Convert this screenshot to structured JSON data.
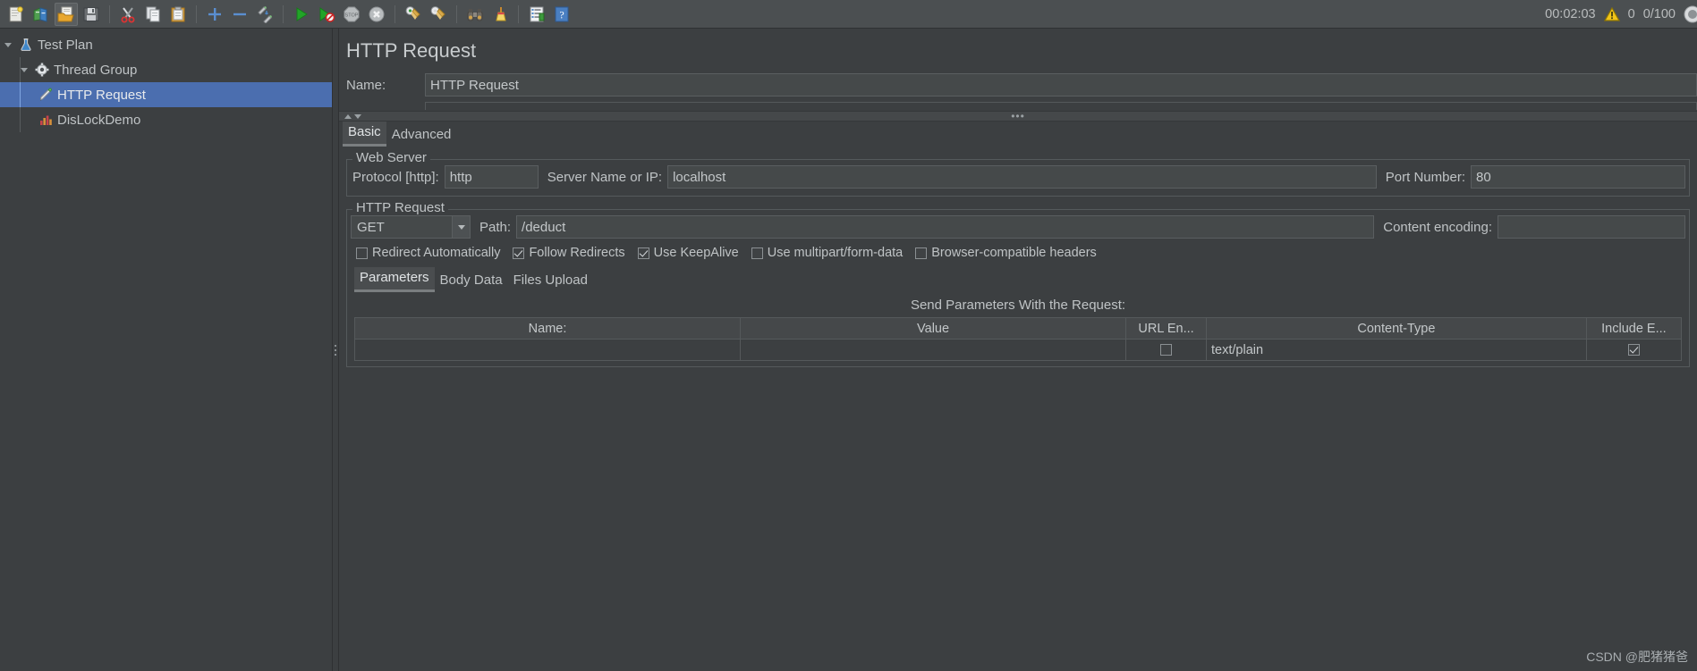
{
  "toolbar": {
    "buttons": [
      {
        "name": "new-test-plan",
        "icon": "new-document-icon"
      },
      {
        "name": "templates",
        "icon": "templates-icon"
      },
      {
        "name": "open",
        "icon": "open-folder-icon"
      },
      {
        "name": "save",
        "icon": "save-disk-icon"
      },
      {
        "name": "cut",
        "icon": "scissors-icon"
      },
      {
        "name": "copy",
        "icon": "copy-icon"
      },
      {
        "name": "paste",
        "icon": "clipboard-paste-icon"
      },
      {
        "name": "expand-all",
        "icon": "plus-icon"
      },
      {
        "name": "collapse-all",
        "icon": "minus-icon"
      },
      {
        "name": "toggle",
        "icon": "toggle-pencil-icon"
      },
      {
        "name": "start",
        "icon": "play-green-icon"
      },
      {
        "name": "start-no-timers",
        "icon": "play-no-timer-icon"
      },
      {
        "name": "stop",
        "icon": "stop-sign-icon"
      },
      {
        "name": "shutdown",
        "icon": "shutdown-x-icon"
      },
      {
        "name": "clear",
        "icon": "clear-broom-icon"
      },
      {
        "name": "clear-all",
        "icon": "clear-all-broom-icon"
      },
      {
        "name": "search",
        "icon": "binoculars-icon"
      },
      {
        "name": "reset-search",
        "icon": "reset-broom-icon"
      },
      {
        "name": "function-helper",
        "icon": "function-helper-icon"
      },
      {
        "name": "help",
        "icon": "help-question-icon"
      }
    ]
  },
  "status": {
    "elapsed_time": "00:02:03",
    "warning_icon": "warning-triangle-icon",
    "warning_count": "0",
    "threads": "0/100",
    "threads_icon": "threads-circle-icon"
  },
  "tree": {
    "items": [
      {
        "label": "Test Plan",
        "icon": "test-plan-flask-icon",
        "indent": 0,
        "expanded": true,
        "selected": false
      },
      {
        "label": "Thread Group",
        "icon": "thread-group-gear-icon",
        "indent": 1,
        "expanded": true,
        "selected": false
      },
      {
        "label": "HTTP Request",
        "icon": "http-request-pencil-icon",
        "indent": 2,
        "expanded": false,
        "selected": true
      },
      {
        "label": "DisLockDemo",
        "icon": "listener-chart-icon",
        "indent": 2,
        "expanded": false,
        "selected": false
      }
    ]
  },
  "panel": {
    "title": "HTTP Request",
    "name_label": "Name:",
    "name_value": "HTTP Request",
    "tabs": [
      {
        "label": "Basic",
        "active": true
      },
      {
        "label": "Advanced",
        "active": false
      }
    ]
  },
  "web_server": {
    "group_title": "Web Server",
    "protocol_label": "Protocol [http]:",
    "protocol_value": "http",
    "server_label": "Server Name or IP:",
    "server_value": "localhost",
    "port_label": "Port Number:",
    "port_value": "80"
  },
  "http_request": {
    "group_title": "HTTP Request",
    "method_value": "GET",
    "path_label": "Path:",
    "path_value": "/deduct",
    "content_encoding_label": "Content encoding:",
    "content_encoding_value": "",
    "checkboxes": [
      {
        "label": "Redirect Automatically",
        "checked": false
      },
      {
        "label": "Follow Redirects",
        "checked": true
      },
      {
        "label": "Use KeepAlive",
        "checked": true
      },
      {
        "label": "Use multipart/form-data",
        "checked": false
      },
      {
        "label": "Browser-compatible headers",
        "checked": false
      }
    ]
  },
  "parameters": {
    "tabs": [
      {
        "label": "Parameters",
        "active": true
      },
      {
        "label": "Body Data",
        "active": false
      },
      {
        "label": "Files Upload",
        "active": false
      }
    ],
    "caption": "Send Parameters With the Request:",
    "columns": [
      "Name:",
      "Value",
      "URL En...",
      "Content-Type",
      "Include E..."
    ],
    "rows": [
      {
        "name": "",
        "value": "",
        "url_encode": false,
        "content_type": "text/plain",
        "include_equals": true
      }
    ]
  },
  "watermark": "CSDN @肥猪猪爸",
  "colors": {
    "background": "#3c3f41",
    "toolbar": "#4b4f51",
    "selection": "#4b6eaf",
    "text": "#bfc3c5",
    "field_bg": "#45494a",
    "border": "#55595b"
  }
}
